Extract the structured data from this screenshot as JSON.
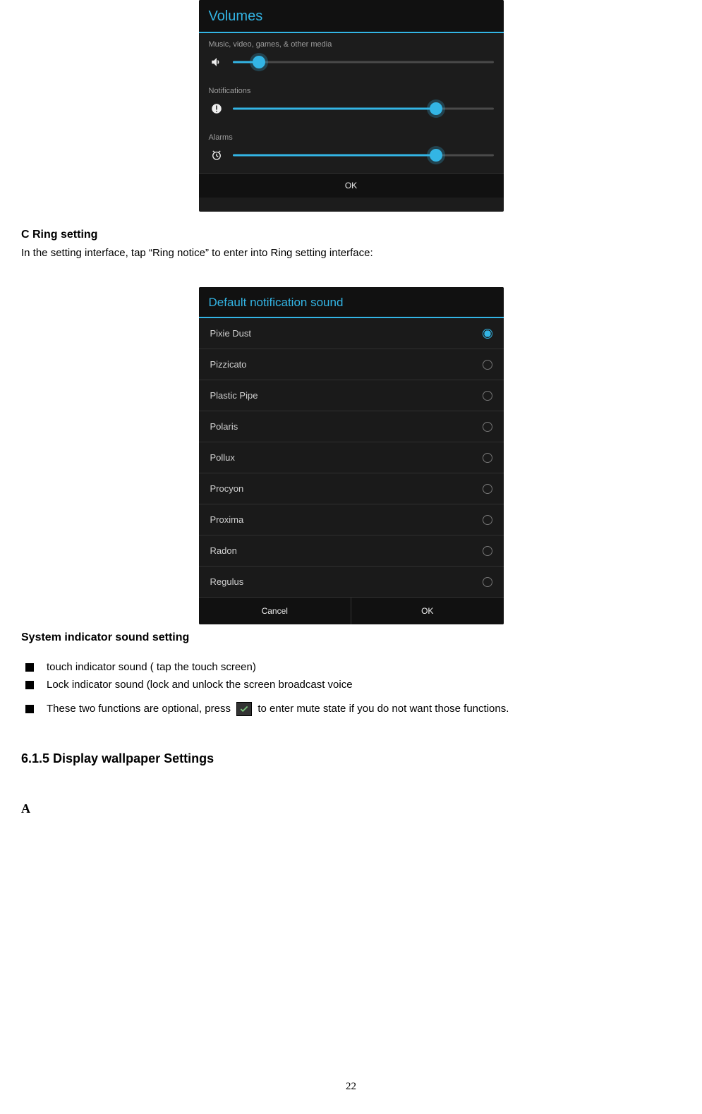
{
  "volumes": {
    "title": "Volumes",
    "sections": [
      {
        "label": "Music, video, games, & other media",
        "fill_pct": 10,
        "icon": "speaker"
      },
      {
        "label": "Notifications",
        "fill_pct": 78,
        "icon": "exclaim"
      },
      {
        "label": "Alarms",
        "fill_pct": 78,
        "icon": "alarm"
      }
    ],
    "ok_label": "OK"
  },
  "ring_heading": "C    Ring setting",
  "ring_intro": "In the setting interface, tap “Ring notice” to enter into Ring setting interface:",
  "notif_sounds": {
    "title": "Default notification sound",
    "items": [
      {
        "name": "Pixie Dust",
        "selected": true
      },
      {
        "name": "Pizzicato",
        "selected": false
      },
      {
        "name": "Plastic Pipe",
        "selected": false
      },
      {
        "name": "Polaris",
        "selected": false
      },
      {
        "name": "Pollux",
        "selected": false
      },
      {
        "name": "Procyon",
        "selected": false
      },
      {
        "name": "Proxima",
        "selected": false
      },
      {
        "name": "Radon",
        "selected": false
      },
      {
        "name": "Regulus",
        "selected": false
      }
    ],
    "cancel_label": "Cancel",
    "ok_label": "OK"
  },
  "sys_indicator_heading": "System indicator sound setting",
  "bullets": {
    "b1": "touch indicator sound ( tap the touch screen)",
    "b2": "Lock indicator sound (lock and unlock the screen broadcast voice",
    "b3a": "These two functions are optional, press",
    "b3b": "to enter mute state if you do not want those functions."
  },
  "display_heading": "6.1.5 Display wallpaper Settings",
  "sub_a": "A",
  "page_number": "22"
}
